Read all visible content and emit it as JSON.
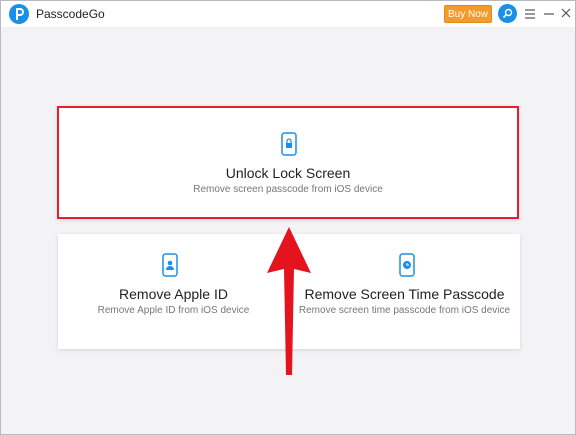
{
  "app": {
    "title": "PasscodeGo"
  },
  "toolbar": {
    "buy_label": "Buy Now"
  },
  "main_option": {
    "title": "Unlock Lock Screen",
    "subtitle": "Remove screen passcode from iOS device"
  },
  "options": [
    {
      "title": "Remove Apple ID",
      "subtitle": "Remove Apple ID from iOS device"
    },
    {
      "title": "Remove Screen Time Passcode",
      "subtitle": "Remove screen time passcode from iOS device"
    }
  ],
  "colors": {
    "brand": "#1a8fe8",
    "buy_button": "#f49b2a",
    "highlight": "#e4202c"
  },
  "icons": [
    "logo-icon",
    "search-icon",
    "menu-icon",
    "minimize-icon",
    "close-icon",
    "phone-lock-icon",
    "phone-user-icon",
    "phone-clock-icon",
    "red-arrow"
  ]
}
